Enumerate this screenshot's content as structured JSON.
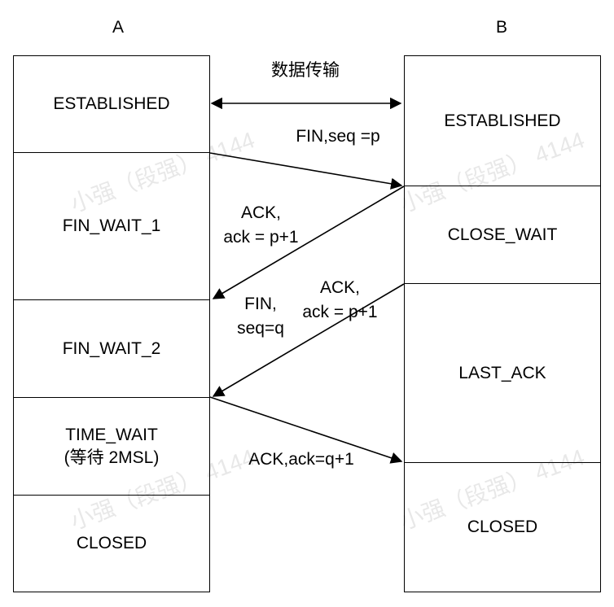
{
  "columns": {
    "a": "A",
    "b": "B"
  },
  "a_states": [
    "ESTABLISHED",
    "FIN_WAIT_1",
    "FIN_WAIT_2",
    "TIME_WAIT\n(等待 2MSL)",
    "CLOSED"
  ],
  "b_states": [
    "ESTABLISHED",
    "CLOSE_WAIT",
    "LAST_ACK",
    "CLOSED"
  ],
  "messages": {
    "data": "数据传输",
    "fin1": "FIN,seq =p",
    "ack1": "ACK,\nack = p+1",
    "ack_b": "ACK,\nack = p+1",
    "fin2": "FIN,\nseq=q",
    "ack2": "ACK,ack=q+1"
  },
  "watermark": "小强（段强） 4144"
}
